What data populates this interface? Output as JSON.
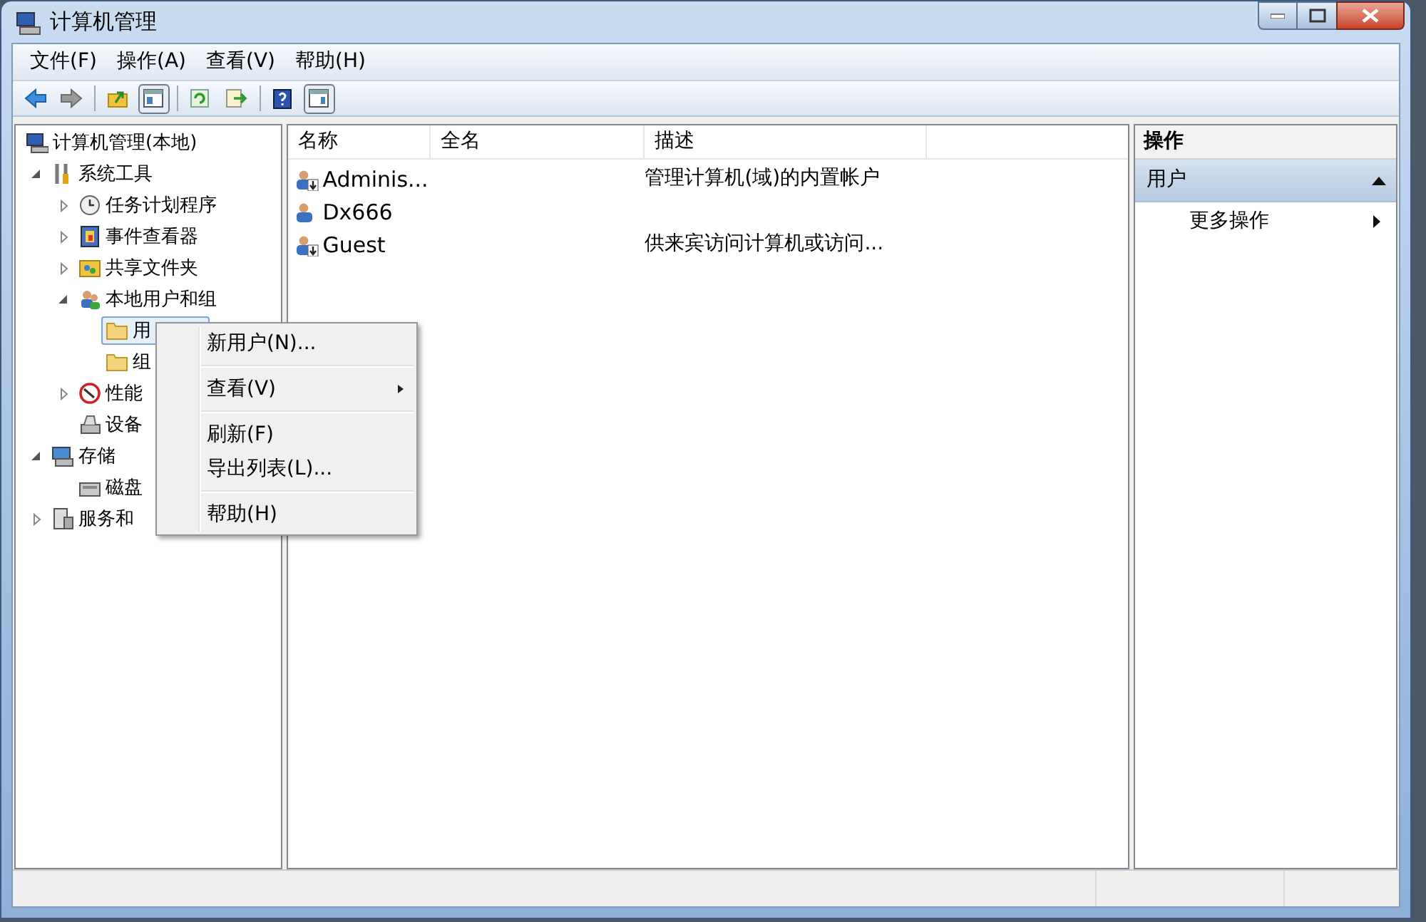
{
  "window": {
    "title": "计算机管理"
  },
  "menu_bar": [
    "文件(F)",
    "操作(A)",
    "查看(V)",
    "帮助(H)"
  ],
  "toolbar": [
    {
      "kind": "back",
      "pressed": false
    },
    {
      "kind": "forward",
      "pressed": false
    },
    {
      "kind": "separator"
    },
    {
      "kind": "folder-up",
      "pressed": false
    },
    {
      "kind": "tree-pane",
      "pressed": true
    },
    {
      "kind": "separator"
    },
    {
      "kind": "refresh",
      "pressed": false
    },
    {
      "kind": "export",
      "pressed": false
    },
    {
      "kind": "separator"
    },
    {
      "kind": "help",
      "pressed": false
    },
    {
      "kind": "action-pane",
      "pressed": true
    }
  ],
  "tree": [
    {
      "label": "计算机管理(本地)",
      "kind": "computer",
      "selected": false,
      "children": [
        {
          "label": "系统工具",
          "kind": "tools",
          "expanded": true,
          "selected": false,
          "children": [
            {
              "label": "任务计划程序",
              "kind": "clock",
              "expanded": false,
              "selected": false
            },
            {
              "label": "事件查看器",
              "kind": "event",
              "expanded": false,
              "selected": false
            },
            {
              "label": "共享文件夹",
              "kind": "share",
              "expanded": false,
              "selected": false
            },
            {
              "label": "本地用户和组",
              "kind": "users",
              "expanded": true,
              "selected": false,
              "children": [
                {
                  "label": "用",
                  "kind": "folder",
                  "selected": true
                },
                {
                  "label": "组",
                  "kind": "folder",
                  "selected": false
                }
              ]
            },
            {
              "label": "性能",
              "kind": "perf",
              "expanded": false,
              "selected": false
            },
            {
              "label": "设备",
              "kind": "device",
              "selected": false
            }
          ]
        },
        {
          "label": "存储",
          "kind": "storage",
          "expanded": true,
          "selected": false,
          "children": [
            {
              "label": "磁盘",
              "kind": "disk",
              "selected": false
            }
          ]
        },
        {
          "label": "服务和",
          "kind": "services",
          "expanded": false,
          "selected": false
        }
      ]
    }
  ],
  "list": {
    "columns": [
      "名称",
      "全名",
      "描述"
    ],
    "rows": [
      {
        "name": "Adminis...",
        "description": "管理计算机(域)的内置帐户",
        "disabled": true
      },
      {
        "name": "Dx666",
        "disabled": false
      },
      {
        "name": "Guest",
        "description": "供来宾访问计算机或访问...",
        "disabled": true
      }
    ]
  },
  "context_menu": [
    [
      {
        "label": "新用户(N)...",
        "submenu": false
      }
    ],
    [
      {
        "label": "查看(V)",
        "submenu": true
      }
    ],
    [
      {
        "label": "刷新(F)",
        "submenu": false
      },
      {
        "label": "导出列表(L)...",
        "submenu": false
      }
    ],
    [
      {
        "label": "帮助(H)",
        "submenu": false
      }
    ]
  ],
  "actions": {
    "title": "操作",
    "sections": [
      {
        "label": "用户",
        "expanded": true,
        "items": [
          {
            "label": "更多操作",
            "submenu": true
          }
        ]
      }
    ]
  }
}
